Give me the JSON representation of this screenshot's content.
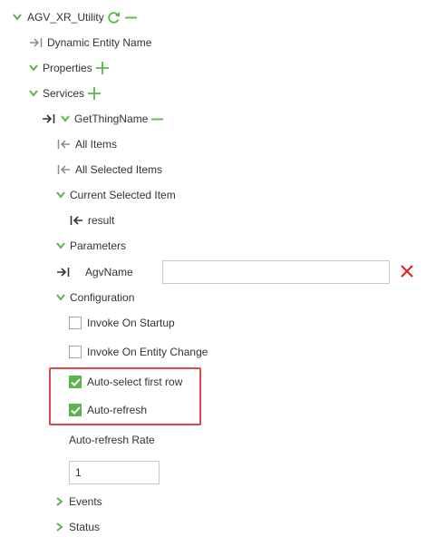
{
  "colors": {
    "accent": "#5bb54a",
    "delete": "#e0242a",
    "highlight": "#e0464b"
  },
  "tree": {
    "root": {
      "label": "AGV_XR_Utility",
      "icons": [
        "chevron-down-icon",
        "refresh-icon",
        "minus-icon"
      ]
    },
    "dynamic_entity": {
      "label": "Dynamic Entity Name",
      "icon": "arrow-in-icon"
    },
    "properties": {
      "label": "Properties",
      "icons": [
        "chevron-down-icon",
        "plus-icon"
      ]
    },
    "services": {
      "label": "Services",
      "icons": [
        "chevron-down-icon",
        "plus-icon"
      ]
    },
    "service": {
      "label": "GetThingName",
      "icons": [
        "arrow-in-icon",
        "chevron-down-icon",
        "minus-icon"
      ],
      "all_items": "All Items",
      "all_selected_items": "All Selected Items",
      "current_selected_item": "Current Selected Item",
      "result": "result",
      "parameters": "Parameters",
      "param_agvname": {
        "label": "AgvName",
        "value": ""
      },
      "configuration": "Configuration",
      "invoke_on_startup": {
        "label": "Invoke On Startup",
        "checked": false
      },
      "invoke_on_entity_change": {
        "label": "Invoke On Entity Change",
        "checked": false
      },
      "auto_select_first_row": {
        "label": "Auto-select first row",
        "checked": true
      },
      "auto_refresh": {
        "label": "Auto-refresh",
        "checked": true
      },
      "auto_refresh_rate": {
        "label": "Auto-refresh Rate",
        "value": "1"
      },
      "events": "Events",
      "status": "Status"
    }
  }
}
